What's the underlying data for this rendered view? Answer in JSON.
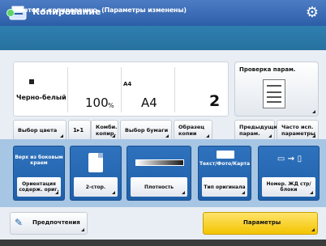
{
  "header": {
    "title": "Копирование"
  },
  "status": {
    "text": "Готов к копированию. (Параметры изменены)"
  },
  "summary": {
    "color": "Черно-белый",
    "zoom": "100",
    "zoom_unit": "%",
    "paper_label": "A4",
    "paper": "A4",
    "copies": "2"
  },
  "preview": {
    "label": "Проверка парам."
  },
  "functions": {
    "color_select": "Выбор цвета",
    "duplex_mode": "1▸1",
    "combine": "Комби. копир.",
    "paper_select": "Выбор бумаги",
    "sample": "Образец копии",
    "previous": "Предыдущие парам.",
    "frequent": "Часто исп. параметры"
  },
  "tiles": {
    "t1_top": "Верх из боковым краем",
    "t1_bottom": "Ориентация содерж. ориг.",
    "t2_bottom": "2-стор.",
    "t3_bottom": "Плотность",
    "t4_top": "Текст/Фото/Карта",
    "t4_bottom": "Тип оригинала",
    "t5_bottom": "Номер. ЖД стр/блоки"
  },
  "bottom": {
    "favorites": "Предпочтения",
    "params": "Параметры"
  },
  "colors": {
    "header": "#2c5ea8",
    "status": "#2a78a8",
    "accent_yellow": "#f3c400",
    "tile_blue": "#1f5fa8"
  }
}
